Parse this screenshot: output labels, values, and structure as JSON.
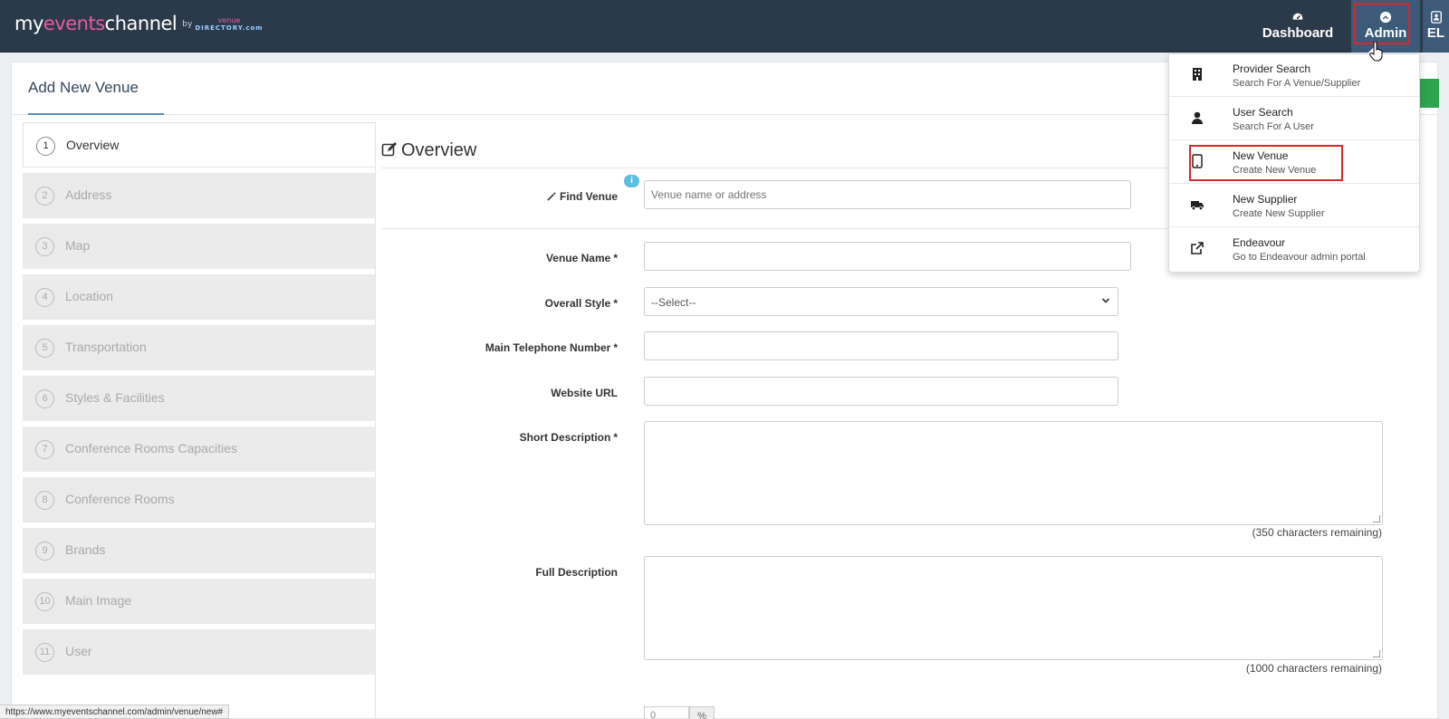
{
  "brand": {
    "my": "my",
    "events": "events",
    "channel": "channel",
    "by": "by",
    "venue": "venue",
    "directory": "DIRECTORY.com"
  },
  "topnav": {
    "dashboard": "Dashboard",
    "admin": "Admin",
    "user_initials": "EL"
  },
  "page": {
    "title": "Add New Venue"
  },
  "steps": [
    {
      "num": "1",
      "label": "Overview"
    },
    {
      "num": "2",
      "label": "Address"
    },
    {
      "num": "3",
      "label": "Map"
    },
    {
      "num": "4",
      "label": "Location"
    },
    {
      "num": "5",
      "label": "Transportation"
    },
    {
      "num": "6",
      "label": "Styles & Facilities"
    },
    {
      "num": "7",
      "label": "Conference Rooms Capacities"
    },
    {
      "num": "8",
      "label": "Conference Rooms"
    },
    {
      "num": "9",
      "label": "Brands"
    },
    {
      "num": "10",
      "label": "Main Image"
    },
    {
      "num": "11",
      "label": "User"
    }
  ],
  "form": {
    "section_title": "Overview",
    "info": "i",
    "find_venue_label": "Find Venue",
    "find_venue_placeholder": "Venue name or address",
    "venue_name_label": "Venue Name",
    "overall_style_label": "Overall Style",
    "overall_style_value": "--Select--",
    "telephone_label": "Main Telephone Number",
    "website_label": "Website URL",
    "short_desc_label": "Short Description",
    "short_desc_remaining": "(350 characters remaining)",
    "full_desc_label": "Full Description",
    "full_desc_remaining": "(1000 characters remaining)",
    "required_mark": "*",
    "partial_value": "0",
    "partial_addon": "%"
  },
  "admin_menu": [
    {
      "title": "Provider Search",
      "sub": "Search For A Venue/Supplier",
      "icon": "building-icon"
    },
    {
      "title": "User Search",
      "sub": "Search For A User",
      "icon": "user-icon"
    },
    {
      "title": "New Venue",
      "sub": "Create New Venue",
      "icon": "tablet-icon"
    },
    {
      "title": "New Supplier",
      "sub": "Create New Supplier",
      "icon": "truck-icon"
    },
    {
      "title": "Endeavour",
      "sub": "Go to Endeavour admin portal",
      "icon": "external-link-icon"
    }
  ],
  "status_url": "https://www.myeventschannel.com/admin/venue/new#",
  "colors": {
    "topbar": "#2b3a4a",
    "admin_active": "#3b5b78",
    "highlight": "#d9262c",
    "brand_pink": "#e85aa7",
    "info": "#5bc0de"
  }
}
